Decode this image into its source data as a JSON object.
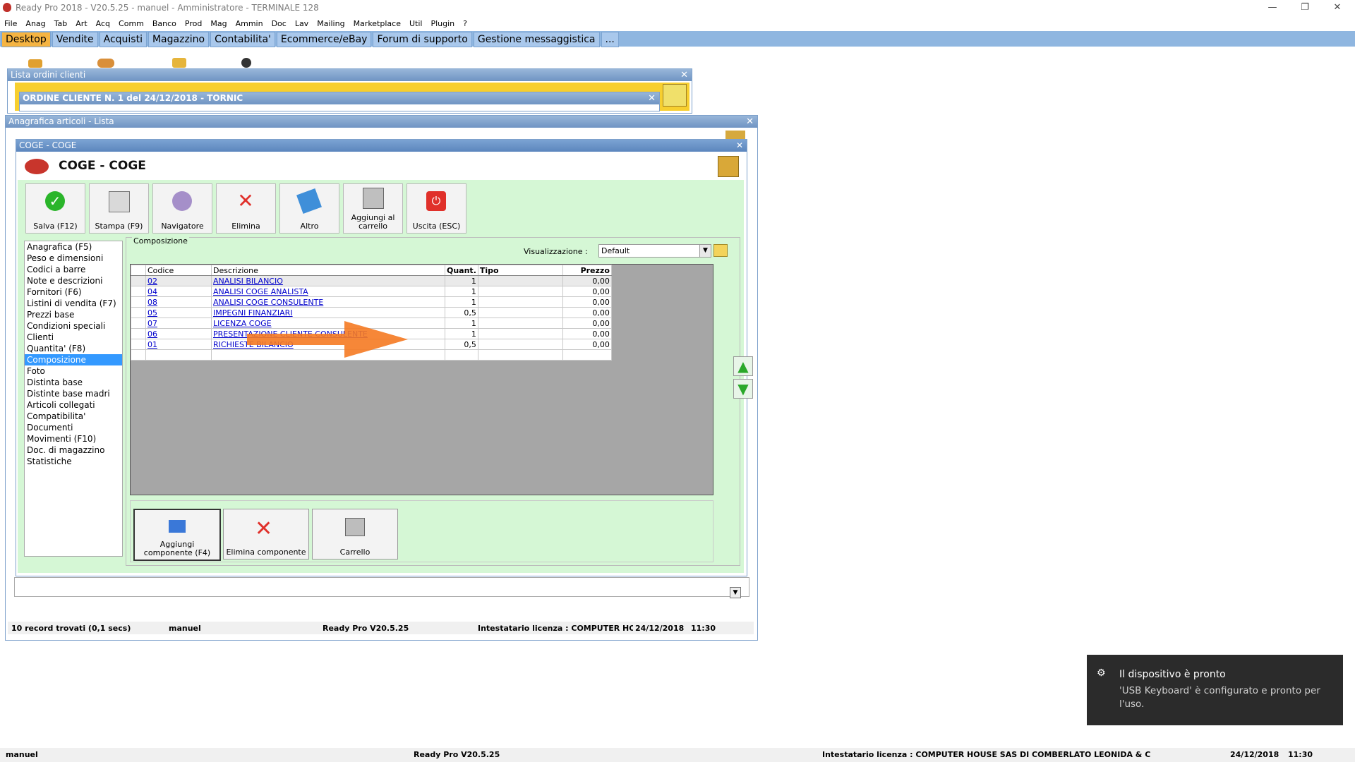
{
  "window": {
    "title": "Ready Pro 2018 - V20.5.25 - manuel - Amministratore - TERMINALE 128",
    "minimize": "—",
    "restore": "❐",
    "close": "✕"
  },
  "menu": [
    "File",
    "Anag",
    "Tab",
    "Art",
    "Acq",
    "Comm",
    "Banco",
    "Prod",
    "Mag",
    "Ammin",
    "Doc",
    "Lav",
    "Mailing",
    "Marketplace",
    "Util",
    "Plugin",
    "?"
  ],
  "tabs": [
    "Desktop",
    "Vendite",
    "Acquisti",
    "Magazzino",
    "Contabilita'",
    "Ecommerce/eBay",
    "Forum di supporto",
    "Gestione messaggistica",
    "..."
  ],
  "bg_windows": {
    "lista_ordini": "Lista ordini clienti",
    "ordine_cliente": "ORDINE CLIENTE N. 1 del 24/12/2018 - TORNIC",
    "anagrafica": "Anagrafica articoli  - Lista"
  },
  "coge": {
    "window_title": "COGE - COGE",
    "header": "COGE - COGE",
    "toolbar": [
      {
        "label": "Salva (F12)",
        "icon": "check-icon"
      },
      {
        "label": "Stampa (F9)",
        "icon": "printer-icon"
      },
      {
        "label": "Navigatore",
        "icon": "compass-icon"
      },
      {
        "label": "Elimina",
        "icon": "delete-x-icon"
      },
      {
        "label": "Altro",
        "icon": "magnifier-icon"
      },
      {
        "label": "Aggiungi al carrello",
        "icon": "cart-add-icon"
      },
      {
        "label": "Uscita (ESC)",
        "icon": "exit-icon"
      }
    ],
    "nav_items": [
      "Anagrafica (F5)",
      "Peso e dimensioni",
      "Codici a barre",
      "Note e descrizioni",
      "Fornitori (F6)",
      "Listini di vendita (F7)",
      "Prezzi base",
      "Condizioni speciali",
      "Clienti",
      "Quantita' (F8)",
      "Composizione",
      "Foto",
      "Distinta base",
      "Distinte base madri",
      "Articoli collegati",
      "Compatibilita'",
      "Documenti",
      "Movimenti (F10)",
      "Doc. di magazzino",
      "Statistiche"
    ],
    "nav_selected": 10,
    "composizione": {
      "legend": "Composizione",
      "visualizzazione_label": "Visualizzazione :",
      "visualizzazione_value": "Default",
      "columns": [
        "Codice",
        "Descrizione",
        "Quant.",
        "Tipo",
        "Prezzo"
      ],
      "rows": [
        {
          "codice": "02",
          "descrizione": "ANALISI BILANCIO",
          "quant": "1",
          "tipo": "",
          "prezzo": "0,00"
        },
        {
          "codice": "04",
          "descrizione": "ANALISI COGE ANALISTA",
          "quant": "1",
          "tipo": "",
          "prezzo": "0,00"
        },
        {
          "codice": "08",
          "descrizione": "ANALISI COGE CONSULENTE",
          "quant": "1",
          "tipo": "",
          "prezzo": "0,00"
        },
        {
          "codice": "05",
          "descrizione": "IMPEGNI FINANZIARI",
          "quant": "0,5",
          "tipo": "",
          "prezzo": "0,00"
        },
        {
          "codice": "07",
          "descrizione": "LICENZA COGE",
          "quant": "1",
          "tipo": "",
          "prezzo": "0,00"
        },
        {
          "codice": "06",
          "descrizione": "PRESENTAZIONE CLIENTE CONSULENTE",
          "quant": "1",
          "tipo": "",
          "prezzo": "0,00"
        },
        {
          "codice": "01",
          "descrizione": "RICHIESTE BILANCIO",
          "quant": "0,5",
          "tipo": "",
          "prezzo": "0,00"
        }
      ],
      "buttons": [
        "Aggiungi componente (F4)",
        "Elimina componente",
        "Carrello"
      ]
    }
  },
  "inner_status": {
    "records": "10 record trovati (0,1 secs)",
    "user": "manuel",
    "version": "Ready Pro V20.5.25",
    "license": "Intestatario licenza : COMPUTER HOUS",
    "date": "24/12/2018",
    "time": "11:30"
  },
  "status": {
    "user": "manuel",
    "version": "Ready Pro V20.5.25",
    "license": "Intestatario licenza : COMPUTER HOUSE SAS DI COMBERLATO LEONIDA & C",
    "date": "24/12/2018",
    "time": "11:30"
  },
  "toast": {
    "title": "Il dispositivo è pronto",
    "body": "'USB Keyboard' è configurato e pronto per l'uso."
  },
  "colors": {
    "accent_tab": "#f5b442",
    "tabbar": "#8fb6e0",
    "panel": "#d5f7d5",
    "arrow": "#f57a22"
  }
}
